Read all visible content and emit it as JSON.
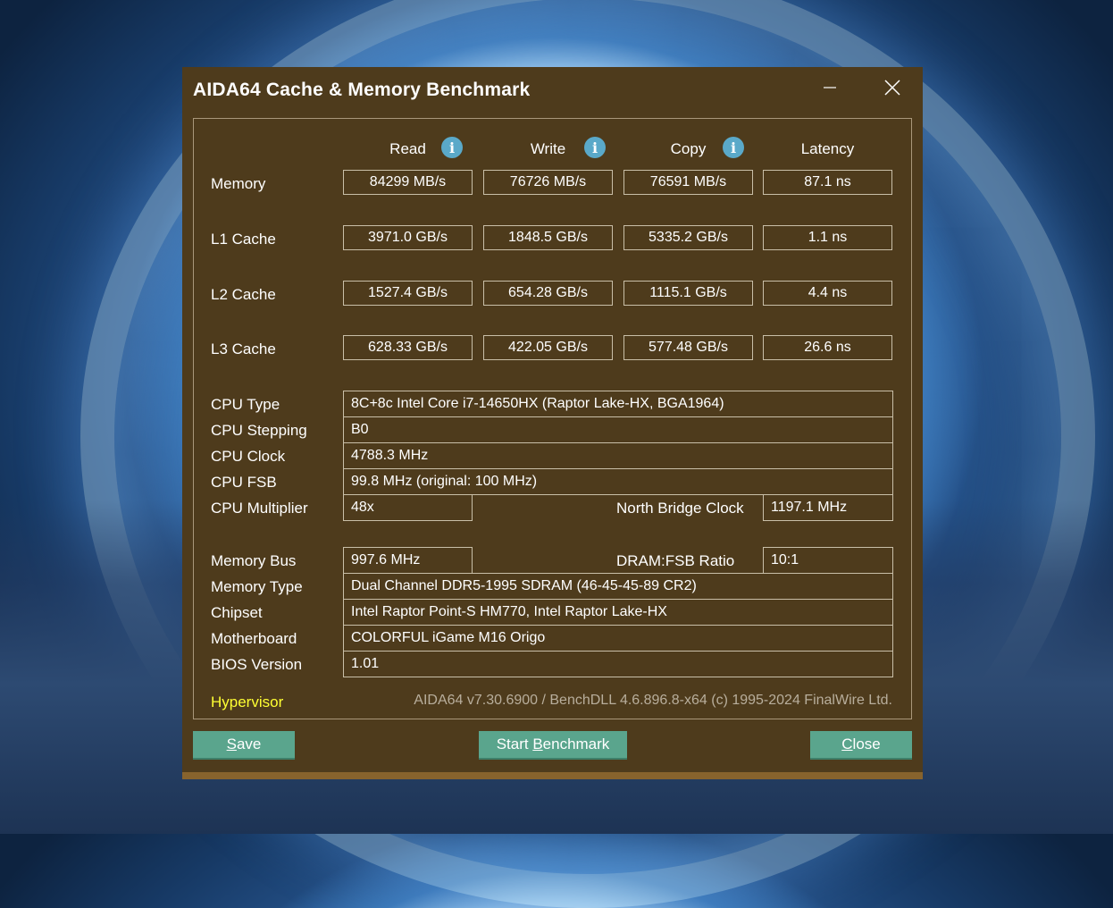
{
  "window": {
    "title": "AIDA64 Cache & Memory Benchmark"
  },
  "columns": {
    "read": "Read",
    "write": "Write",
    "copy": "Copy",
    "latency": "Latency"
  },
  "rows": [
    {
      "label": "Memory",
      "read": "84299 MB/s",
      "write": "76726 MB/s",
      "copy": "76591 MB/s",
      "latency": "87.1 ns"
    },
    {
      "label": "L1 Cache",
      "read": "3971.0 GB/s",
      "write": "1848.5 GB/s",
      "copy": "5335.2 GB/s",
      "latency": "1.1 ns"
    },
    {
      "label": "L2 Cache",
      "read": "1527.4 GB/s",
      "write": "654.28 GB/s",
      "copy": "1115.1 GB/s",
      "latency": "4.4 ns"
    },
    {
      "label": "L3 Cache",
      "read": "628.33 GB/s",
      "write": "422.05 GB/s",
      "copy": "577.48 GB/s",
      "latency": "26.6 ns"
    }
  ],
  "cpu": {
    "type_label": "CPU Type",
    "type_value": "8C+8c Intel Core i7-14650HX  (Raptor Lake-HX, BGA1964)",
    "stepping_label": "CPU Stepping",
    "stepping_value": "B0",
    "clock_label": "CPU Clock",
    "clock_value": "4788.3 MHz",
    "fsb_label": "CPU FSB",
    "fsb_value": "99.8 MHz  (original: 100 MHz)",
    "multiplier_label": "CPU Multiplier",
    "multiplier_value": "48x",
    "nb_clock_label": "North Bridge Clock",
    "nb_clock_value": "1197.1 MHz"
  },
  "memory": {
    "bus_label": "Memory Bus",
    "bus_value": "997.6 MHz",
    "ratio_label": "DRAM:FSB Ratio",
    "ratio_value": "10:1",
    "type_label": "Memory Type",
    "type_value": "Dual Channel DDR5-1995 SDRAM  (46-45-45-89 CR2)",
    "chipset_label": "Chipset",
    "chipset_value": "Intel Raptor Point-S HM770, Intel Raptor Lake-HX",
    "motherboard_label": "Motherboard",
    "motherboard_value": "COLORFUL iGame M16 Origo",
    "bios_label": "BIOS Version",
    "bios_value": "1.01"
  },
  "footer": {
    "hypervisor": "Hypervisor",
    "copyright": "AIDA64 v7.30.6900 / BenchDLL 4.6.896.8-x64  (c) 1995-2024 FinalWire Ltd."
  },
  "buttons": {
    "save_mnemonic": "S",
    "save_rest": "ave",
    "start_pre": "Start ",
    "start_mnemonic": "B",
    "start_rest": "enchmark",
    "close_mnemonic": "C",
    "close_rest": "lose"
  },
  "icons": {
    "minimize": "minimize-icon",
    "close": "close-icon",
    "info": "info-icon"
  },
  "colors": {
    "window_bg": "#4e3b1c",
    "button_bg": "#5aa58d",
    "info_icon": "#5aa9c9",
    "hypervisor_text": "#ffff33"
  }
}
